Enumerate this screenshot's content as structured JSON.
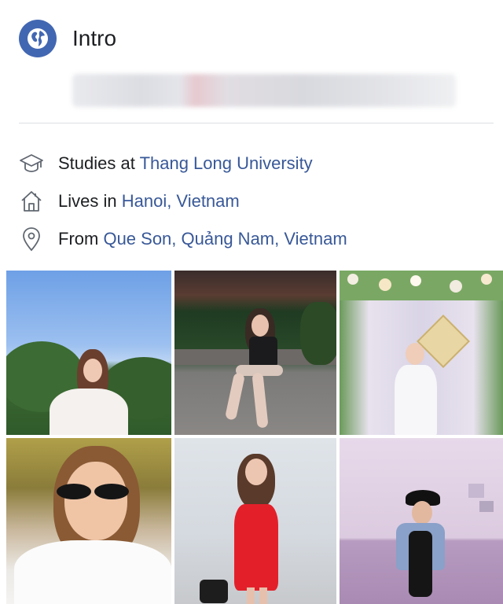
{
  "intro": {
    "title": "Intro",
    "icon": "globe-icon",
    "accent_color": "#4267b2"
  },
  "details": {
    "studies": {
      "prefix": "Studies at ",
      "link": "Thang Long University",
      "icon": "graduation-cap-icon"
    },
    "lives": {
      "prefix": "Lives in ",
      "link": "Hanoi, Vietnam",
      "icon": "home-icon"
    },
    "from": {
      "prefix": "From ",
      "link": "Que Son, Quảng Nam, Vietnam",
      "icon": "location-pin-icon"
    },
    "link_color": "#385898"
  },
  "photos": [
    {
      "name": "photo-1",
      "scene": "girl in white shirt before trees and blue sky"
    },
    {
      "name": "photo-2",
      "scene": "girl sitting on ledge at night"
    },
    {
      "name": "photo-3",
      "scene": "girl in white dress at flower arch"
    },
    {
      "name": "photo-4",
      "scene": "girl with sunglasses in white shirt"
    },
    {
      "name": "photo-5",
      "scene": "girl in red dress with handbag"
    },
    {
      "name": "photo-6",
      "scene": "girl with cap against purple wall"
    }
  ]
}
